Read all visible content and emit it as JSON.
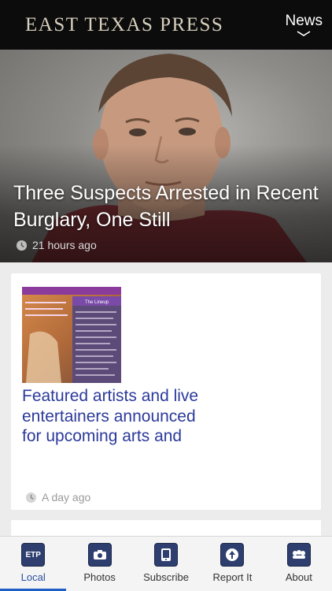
{
  "header": {
    "brand": "EAST TEXAS PRESS",
    "section_dropdown": "News",
    "background": "#0c0c0c"
  },
  "hero": {
    "title": "Three Suspects Arrested in Recent Burglary, One Still",
    "time": "21 hours ago",
    "icon": "clock-icon"
  },
  "cards": [
    {
      "title": "Featured artists and live entertainers announced for upcoming arts and",
      "time": "A day ago",
      "thumbnail": {
        "heading": "The Lineup"
      }
    }
  ],
  "tabbar": {
    "items": [
      {
        "label": "Local",
        "icon": "etp-logo-icon",
        "icon_text": "ETP",
        "active": true
      },
      {
        "label": "Photos",
        "icon": "camera-icon",
        "active": false
      },
      {
        "label": "Subscribe",
        "icon": "tablet-icon",
        "active": false
      },
      {
        "label": "Report It",
        "icon": "upload-icon",
        "active": false
      },
      {
        "label": "About",
        "icon": "people-icon",
        "active": false
      }
    ],
    "accent": "#1f5ec4"
  }
}
